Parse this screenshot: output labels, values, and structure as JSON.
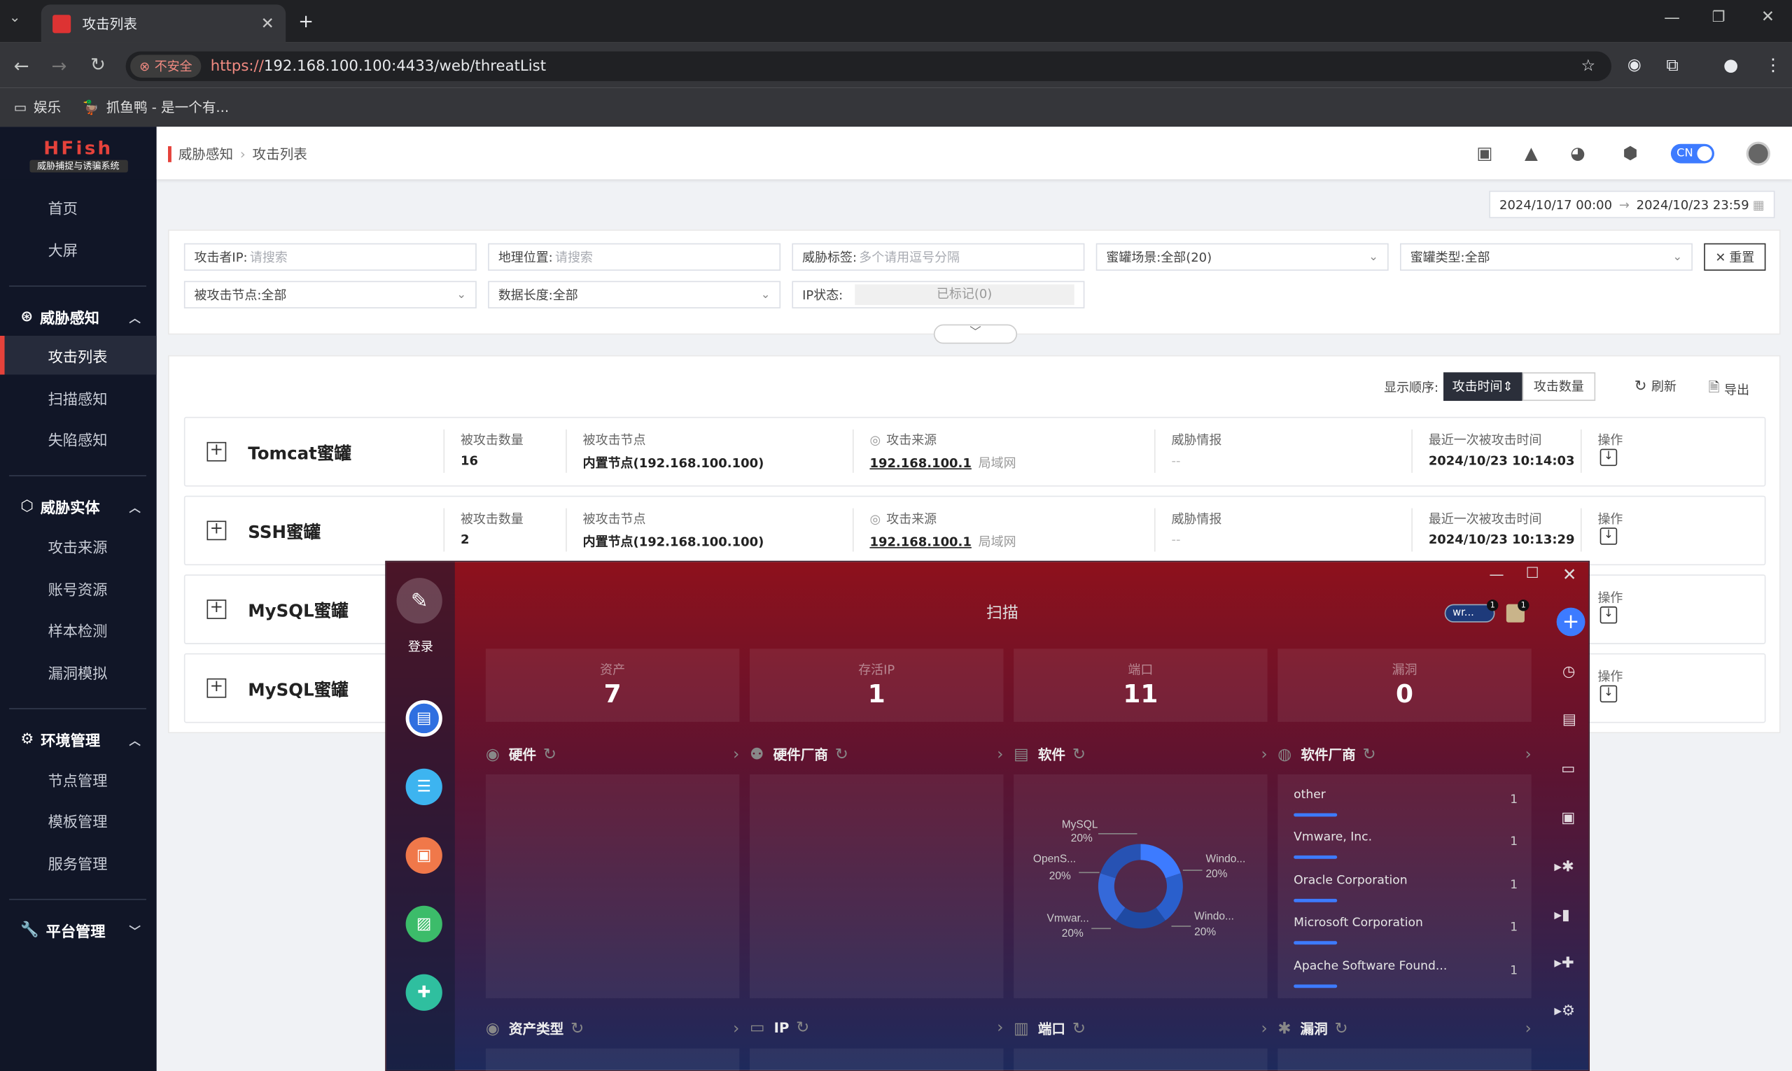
{
  "browser": {
    "tab_title": "攻击列表",
    "security_label": "不安全",
    "url_scheme": "https://",
    "url_rest": "192.168.100.100:4433/web/threatList",
    "bookmarks": [
      "娱乐",
      "抓鱼鸭 - 是一个有..."
    ]
  },
  "app": {
    "logo_title": "HFish",
    "logo_sub": "威胁捕捉与诱骗系统",
    "breadcrumb": [
      "威胁感知",
      "攻击列表"
    ],
    "lang_toggle": "CN"
  },
  "sidebar": {
    "top_items": [
      "首页",
      "大屏"
    ],
    "groups": [
      {
        "label": "威胁感知",
        "items": [
          "攻击列表",
          "扫描感知",
          "失陷感知"
        ]
      },
      {
        "label": "威胁实体",
        "items": [
          "攻击来源",
          "账号资源",
          "样本检测",
          "漏洞模拟"
        ]
      },
      {
        "label": "环境管理",
        "items": [
          "节点管理",
          "模板管理",
          "服务管理"
        ]
      },
      {
        "label": "平台管理",
        "items": []
      }
    ],
    "active_item": "攻击列表"
  },
  "date_range": {
    "start": "2024/10/17 00:00",
    "end": "2024/10/23 23:59"
  },
  "filters": {
    "attacker_ip": {
      "label": "攻击者IP:",
      "placeholder": "请搜索"
    },
    "geo": {
      "label": "地理位置:",
      "placeholder": "请搜索"
    },
    "tags": {
      "label": "威胁标签:",
      "placeholder": "多个请用逗号分隔"
    },
    "scene": {
      "label": "蜜罐场景:",
      "value": "全部(20)"
    },
    "type": {
      "label": "蜜罐类型:",
      "value": "全部"
    },
    "node": {
      "label": "被攻击节点:",
      "value": "全部"
    },
    "length": {
      "label": "数据长度:",
      "value": "全部"
    },
    "ip_status": {
      "label": "IP状态:",
      "value": "已标记(0)"
    },
    "reset": "重置"
  },
  "toolbar": {
    "sort_label": "显示顺序:",
    "sort_time": "攻击时间",
    "sort_count": "攻击数量",
    "refresh": "刷新",
    "export": "导出"
  },
  "columns": {
    "count": "被攻击数量",
    "node": "被攻击节点",
    "source": "攻击来源",
    "intel": "威胁情报",
    "last": "最近一次被攻击时间",
    "ops": "操作"
  },
  "rows": [
    {
      "name": "Tomcat蜜罐",
      "count": "16",
      "node": "内置节点(192.168.100.100)",
      "source": "192.168.100.1",
      "source_tag": "局域网",
      "intel": "--",
      "last": "2024/10/23 10:14:03"
    },
    {
      "name": "SSH蜜罐",
      "count": "2",
      "node": "内置节点(192.168.100.100)",
      "source": "192.168.100.1",
      "source_tag": "局域网",
      "intel": "--",
      "last": "2024/10/23 10:13:29"
    },
    {
      "name": "MySQL蜜罐"
    },
    {
      "name": "MySQL蜜罐"
    }
  ],
  "overlay": {
    "title": "扫描",
    "login": "登录",
    "user_chip": "wr...",
    "badge_count": "1",
    "stats": [
      {
        "label": "资产",
        "value": "7"
      },
      {
        "label": "存活IP",
        "value": "1"
      },
      {
        "label": "端口",
        "value": "11"
      },
      {
        "label": "漏洞",
        "value": "0"
      }
    ],
    "sections_top": [
      "硬件",
      "硬件厂商",
      "软件",
      "软件厂商"
    ],
    "sections_bottom": [
      "资产类型",
      "IP",
      "端口",
      "漏洞"
    ],
    "software_chart": [
      {
        "name": "MySQL",
        "pct": "20%"
      },
      {
        "name": "Windo...",
        "pct": "20%"
      },
      {
        "name": "Windo...",
        "pct": "20%"
      },
      {
        "name": "Vmwar...",
        "pct": "20%"
      },
      {
        "name": "OpenS...",
        "pct": "20%"
      }
    ],
    "vendors": [
      {
        "name": "other",
        "count": "1"
      },
      {
        "name": "Vmware, Inc.",
        "count": "1"
      },
      {
        "name": "Oracle Corporation",
        "count": "1"
      },
      {
        "name": "Microsoft Corporation",
        "count": "1"
      },
      {
        "name": "Apache Software Found...",
        "count": "1"
      }
    ]
  }
}
